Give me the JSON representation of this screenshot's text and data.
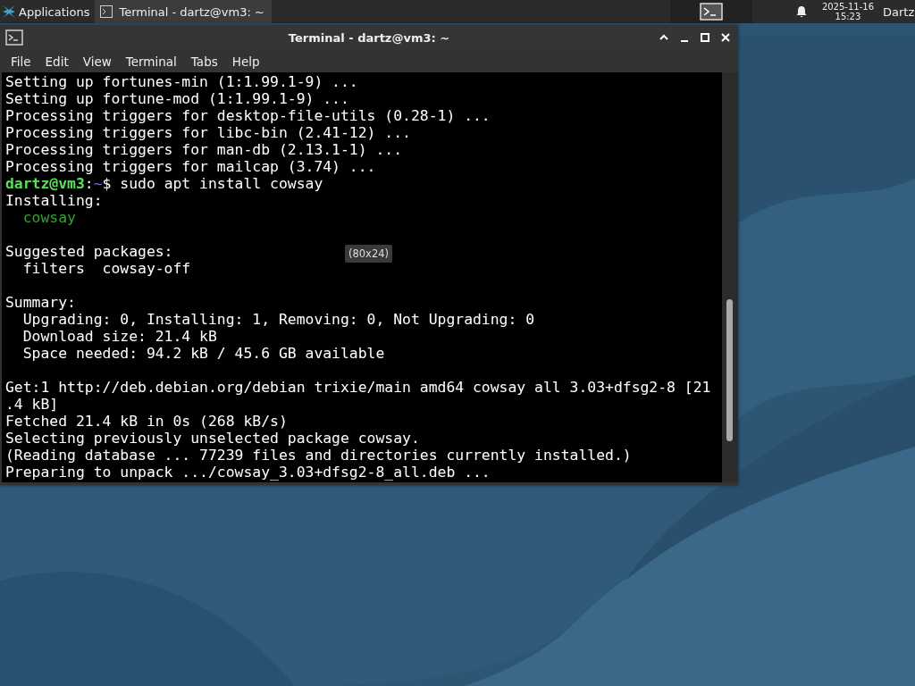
{
  "panel": {
    "applications": "Applications",
    "tasks": [
      {
        "label": "Terminal - dartz@vm3: ~",
        "selected": true
      }
    ],
    "clock": {
      "date": "2025-11-16",
      "time": "15:23"
    },
    "user": "Dartz"
  },
  "window": {
    "title": "Terminal - dartz@vm3: ~",
    "menu": [
      "File",
      "Edit",
      "View",
      "Terminal",
      "Tabs",
      "Help"
    ],
    "lines": [
      {
        "kind": "text",
        "text": "Setting up fortunes-min (1:1.99.1-9) ..."
      },
      {
        "kind": "text",
        "text": "Setting up fortune-mod (1:1.99.1-9) ..."
      },
      {
        "kind": "text",
        "text": "Processing triggers for desktop-file-utils (0.28-1) ..."
      },
      {
        "kind": "text",
        "text": "Processing triggers for libc-bin (2.41-12) ..."
      },
      {
        "kind": "text",
        "text": "Processing triggers for man-db (2.13.1-1) ..."
      },
      {
        "kind": "text",
        "text": "Processing triggers for mailcap (3.74) ..."
      },
      {
        "kind": "prompt",
        "user": "dartz@vm3",
        "sep": ":",
        "path": "~",
        "text": "$ sudo apt install cowsay"
      },
      {
        "kind": "text",
        "text": "Installing:"
      },
      {
        "kind": "package",
        "text": "  cowsay"
      },
      {
        "kind": "blank"
      },
      {
        "kind": "text",
        "text": "Suggested packages:"
      },
      {
        "kind": "text",
        "text": "  filters  cowsay-off"
      },
      {
        "kind": "blank"
      },
      {
        "kind": "text",
        "text": "Summary:"
      },
      {
        "kind": "text",
        "text": "  Upgrading: 0, Installing: 1, Removing: 0, Not Upgrading: 0"
      },
      {
        "kind": "text",
        "text": "  Download size: 21.4 kB"
      },
      {
        "kind": "text",
        "text": "  Space needed: 94.2 kB / 45.6 GB available"
      },
      {
        "kind": "blank"
      },
      {
        "kind": "text",
        "text": "Get:1 http://deb.debian.org/debian trixie/main amd64 cowsay all 3.03+dfsg2-8 [21"
      },
      {
        "kind": "text",
        "text": ".4 kB]"
      },
      {
        "kind": "text",
        "text": "Fetched 21.4 kB in 0s (268 kB/s)"
      },
      {
        "kind": "text",
        "text": "Selecting previously unselected package cowsay."
      },
      {
        "kind": "text",
        "text": "(Reading database ... 77239 files and directories currently installed.)"
      },
      {
        "kind": "text",
        "text": "Preparing to unpack .../cowsay_3.03+dfsg2-8_all.deb ..."
      }
    ],
    "tooltip": "(80x24)"
  }
}
